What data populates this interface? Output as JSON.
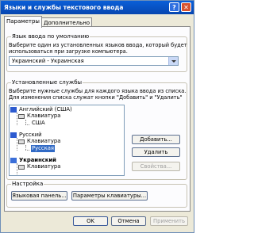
{
  "window": {
    "title": "Языки и службы текстового ввода"
  },
  "tabs": [
    {
      "label": "Параметры"
    },
    {
      "label": "Дополнительно"
    }
  ],
  "default_lang": {
    "group_label": "Язык ввода по умолчанию",
    "description_lines": [
      "Выберите один из установленных языков ввода, который будет",
      "использоваться при загрузке компьютера."
    ],
    "selected": "Украинский - Украинская"
  },
  "services": {
    "group_label": "Установленные службы",
    "description_lines": [
      "Выберите нужные службы для каждого языка ввода из списка.",
      "Для изменения списка служат кнопки \"Добавить\" и \"Удалить\""
    ],
    "tree": {
      "lang1": "Английский (США)",
      "kbd1": "Клавиатура",
      "layout1": "США",
      "lang2": "Русский",
      "kbd2": "Клавиатура",
      "layout2": "Русская",
      "lang3": "Украинский",
      "kbd3": "Клавиатура"
    },
    "add_label": "Добавить...",
    "remove_label": "Удалить",
    "properties_label": "Свойства..."
  },
  "settings": {
    "group_label": "Настройка",
    "language_bar_label": "Языковая панель...",
    "keyboard_params_label": "Параметры клавиатуры..."
  },
  "footer": {
    "ok_label": "OK",
    "cancel_label": "Отмена",
    "apply_label": "Применить"
  }
}
